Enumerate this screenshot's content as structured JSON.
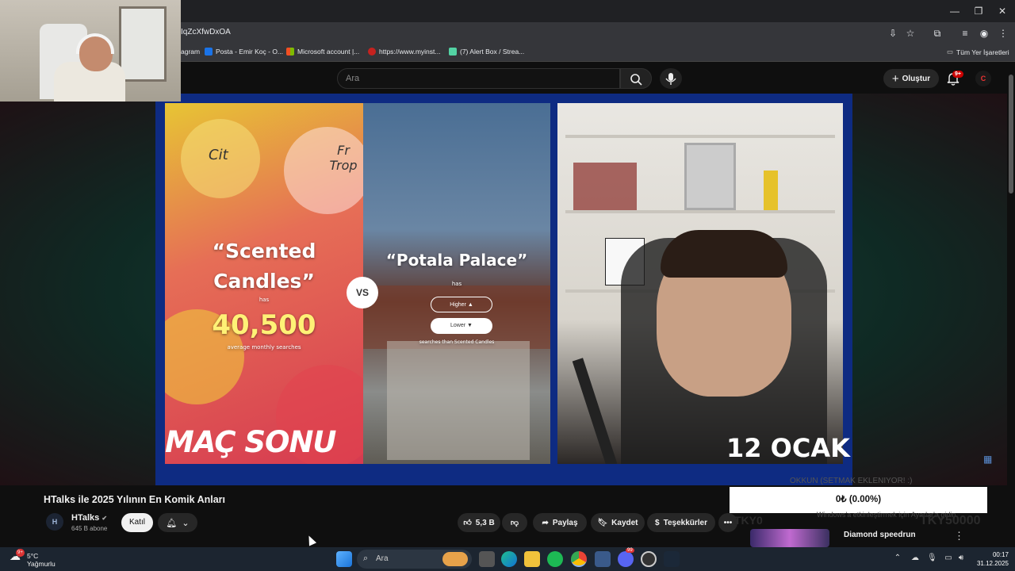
{
  "browser": {
    "url_fragment": "IqZcXfwDxOA",
    "window_controls": [
      "—",
      "❐",
      "✕"
    ],
    "bookmarks": [
      {
        "label": "agram",
        "color": "#d63384"
      },
      {
        "label": "Posta - Emir Koç - O...",
        "color": "#1a73e8"
      },
      {
        "label": "Microsoft account |...",
        "color": "#f25022"
      },
      {
        "label": "https://www.myinst...",
        "color": "#c5221f"
      },
      {
        "label": "(7) Alert Box / Strea...",
        "color": "#53d3a4"
      }
    ],
    "all_bookmarks": "Tüm Yer İşaretleri"
  },
  "youtube_header": {
    "search_placeholder": "Ara",
    "create_label": "Oluştur",
    "notification_count": "9+",
    "avatar_letter": "C"
  },
  "video_overlay": {
    "left_quote": "“Scented Candles”",
    "left_has": "has",
    "left_number": "40,500",
    "left_caption": "average monthly searches",
    "vs": "VS",
    "right_quote": "“Potala Palace”",
    "right_has": "has",
    "higher_label": "Higher ▲",
    "lower_label": "Lower ▼",
    "right_caption": "searches than Scented Candles",
    "banner_left": "MAÇ SONU",
    "banner_right": "12 OCAK",
    "candle_text_1": "Cit",
    "candle_text_2": "Fr Trop"
  },
  "video_info": {
    "title": "HTalks ile 2025 Yılının En Komik Anları",
    "channel_name": "HTalks",
    "channel_verified": "✔",
    "channel_avatar": "H",
    "subscribers": "645 B abone",
    "join_label": "Katıl",
    "like_count": "5,3 B",
    "share_label": "Paylaş",
    "save_label": "Kaydet",
    "thanks_label": "Teşekkürler",
    "more_label": "•••"
  },
  "stream_overlay": {
    "donation_text": "0₺ (0.00%)",
    "faint_top": "OKKUN (SETMAK EKLENIYOR! :)",
    "faint_mid": "Windows'a etkinleştirmek için Ayarlar'a gidin.",
    "left_tag": "TKY0",
    "right_tag": "TKY50000"
  },
  "recommendation": {
    "title": "Diamond speedrun",
    "more": "⋮"
  },
  "taskbar": {
    "temperature": "5°C",
    "condition": "Yağmurlu",
    "weather_badge": "9+",
    "search_placeholder": "Ara",
    "time": "00:17",
    "date": "31.12.2025",
    "discord_badge": "99"
  }
}
